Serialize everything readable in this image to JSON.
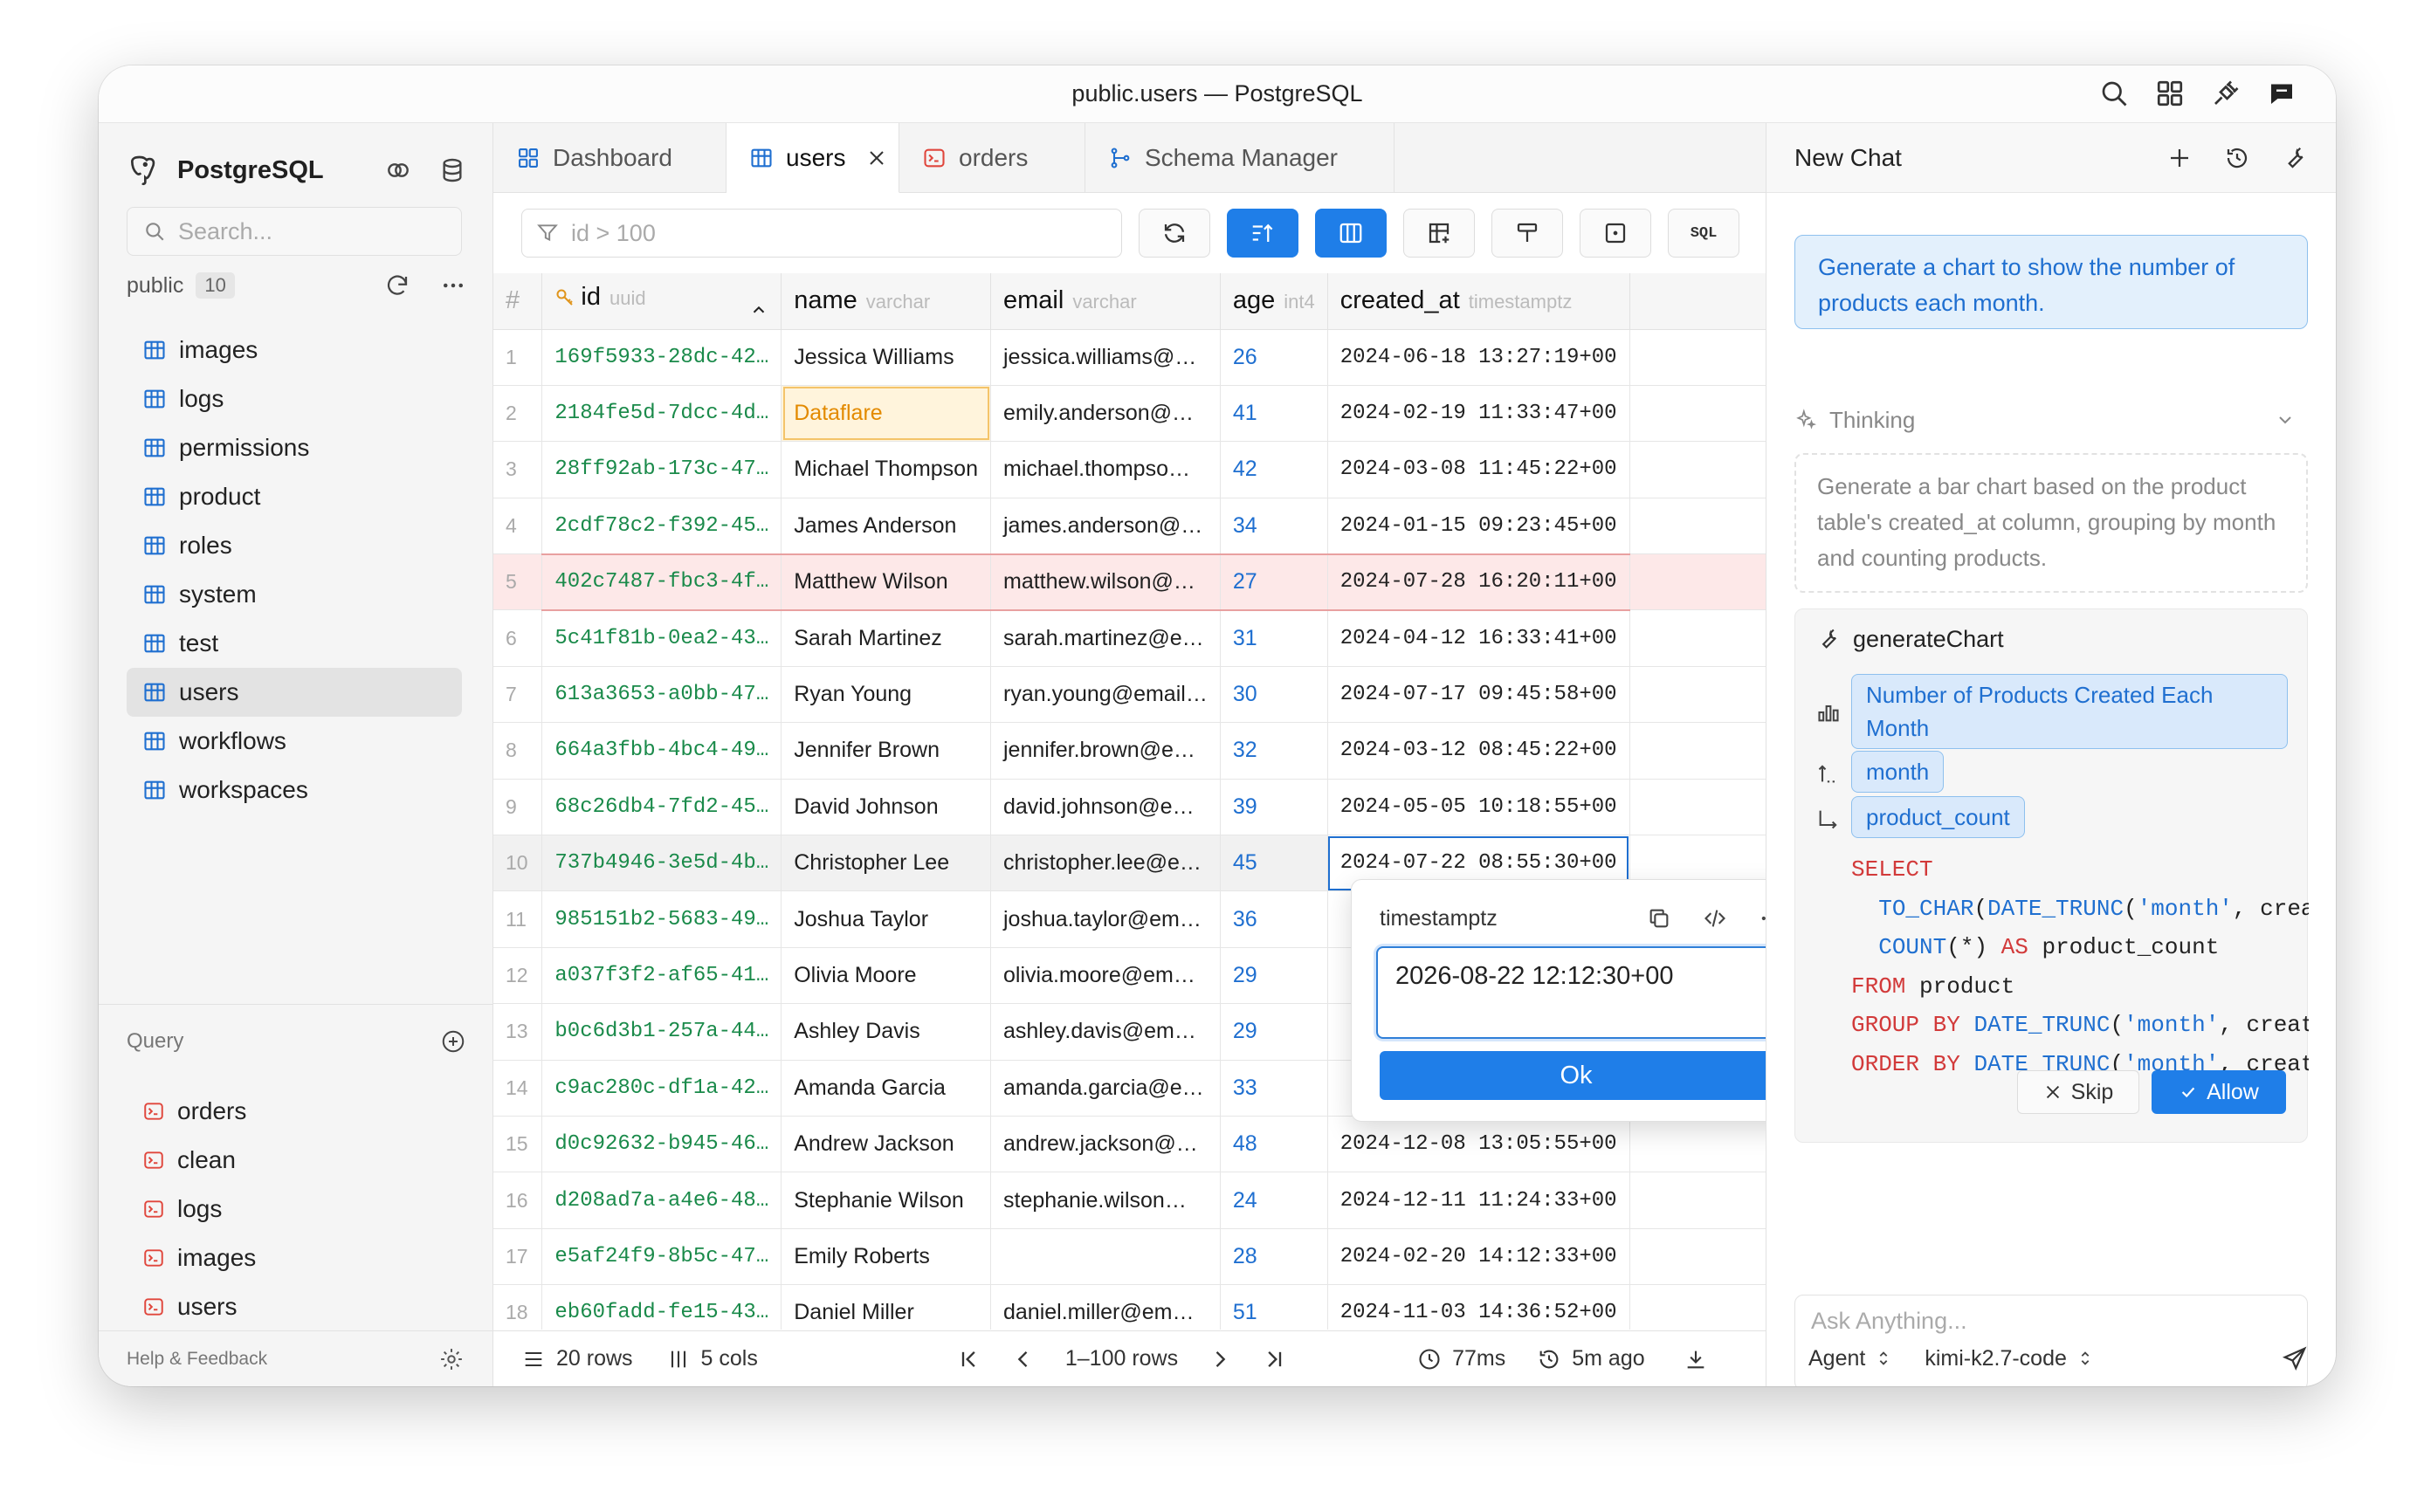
{
  "window": {
    "title": "public.users — PostgreSQL"
  },
  "sidebar": {
    "app_name": "PostgreSQL",
    "search_placeholder": "Search...",
    "schema": {
      "name": "public",
      "count": "10"
    },
    "tables": [
      {
        "label": "images"
      },
      {
        "label": "logs"
      },
      {
        "label": "permissions"
      },
      {
        "label": "product"
      },
      {
        "label": "roles"
      },
      {
        "label": "system"
      },
      {
        "label": "test"
      },
      {
        "label": "users",
        "selected": true
      },
      {
        "label": "workflows"
      },
      {
        "label": "workspaces"
      }
    ],
    "query_header": "Query",
    "queries": [
      {
        "label": "orders"
      },
      {
        "label": "clean"
      },
      {
        "label": "logs"
      },
      {
        "label": "images"
      },
      {
        "label": "users"
      }
    ],
    "footer": "Help & Feedback"
  },
  "tabs": [
    {
      "label": "Dashboard",
      "icon": "dashboard-icon"
    },
    {
      "label": "users",
      "icon": "table-icon",
      "active": true
    },
    {
      "label": "orders",
      "icon": "terminal-icon"
    },
    {
      "label": "Schema Manager",
      "icon": "schema-icon"
    }
  ],
  "toolbar": {
    "filter_placeholder": "id > 100",
    "sql_label": "SQL"
  },
  "grid": {
    "columns": [
      {
        "name": "#",
        "type": ""
      },
      {
        "name": "id",
        "type": "uuid"
      },
      {
        "name": "name",
        "type": "varchar"
      },
      {
        "name": "email",
        "type": "varchar"
      },
      {
        "name": "age",
        "type": "int4"
      },
      {
        "name": "created_at",
        "type": "timestamptz"
      }
    ],
    "rows": [
      {
        "n": "1",
        "id": "169f5933-28dc-42…",
        "name": "Jessica Williams",
        "email": "jessica.williams@…",
        "age": "26",
        "created": "2024-06-18 13:27:19+00"
      },
      {
        "n": "2",
        "id": "2184fe5d-7dcc-4d…",
        "name": "Dataflare",
        "email": "emily.anderson@…",
        "age": "41",
        "created": "2024-02-19 11:33:47+00"
      },
      {
        "n": "3",
        "id": "28ff92ab-173c-47…",
        "name": "Michael Thompson",
        "email": "michael.thompso…",
        "age": "42",
        "created": "2024-03-08 11:45:22+00"
      },
      {
        "n": "4",
        "id": "2cdf78c2-f392-45…",
        "name": "James Anderson",
        "email": "james.anderson@…",
        "age": "34",
        "created": "2024-01-15 09:23:45+00"
      },
      {
        "n": "5",
        "id": "402c7487-fbc3-4f…",
        "name": "Matthew Wilson",
        "email": "matthew.wilson@…",
        "age": "27",
        "created": "2024-07-28 16:20:11+00"
      },
      {
        "n": "6",
        "id": "5c41f81b-0ea2-43…",
        "name": "Sarah Martinez",
        "email": "sarah.martinez@e…",
        "age": "31",
        "created": "2024-04-12 16:33:41+00"
      },
      {
        "n": "7",
        "id": "613a3653-a0bb-47…",
        "name": "Ryan Young",
        "email": "ryan.young@email…",
        "age": "30",
        "created": "2024-07-17 09:45:58+00"
      },
      {
        "n": "8",
        "id": "664a3fbb-4bc4-49…",
        "name": "Jennifer Brown",
        "email": "jennifer.brown@e…",
        "age": "32",
        "created": "2024-03-12 08:45:22+00"
      },
      {
        "n": "9",
        "id": "68c26db4-7fd2-45…",
        "name": "David Johnson",
        "email": "david.johnson@e…",
        "age": "39",
        "created": "2024-05-05 10:18:55+00"
      },
      {
        "n": "10",
        "id": "737b4946-3e5d-4b…",
        "name": "Christopher Lee",
        "email": "christopher.lee@e…",
        "age": "45",
        "created": "2024-07-22 08:55:30+00"
      },
      {
        "n": "11",
        "id": "985151b2-5683-49…",
        "name": "Joshua Taylor",
        "email": "joshua.taylor@em…",
        "age": "36",
        "created": ""
      },
      {
        "n": "12",
        "id": "a037f3f2-af65-41…",
        "name": "Olivia Moore",
        "email": "olivia.moore@em…",
        "age": "29",
        "created": ""
      },
      {
        "n": "13",
        "id": "b0c6d3b1-257a-44…",
        "name": "Ashley Davis",
        "email": "ashley.davis@em…",
        "age": "29",
        "created": ""
      },
      {
        "n": "14",
        "id": "c9ac280c-df1a-42…",
        "name": "Amanda Garcia",
        "email": "amanda.garcia@e…",
        "age": "33",
        "created": ""
      },
      {
        "n": "15",
        "id": "d0c92632-b945-46…",
        "name": "Andrew Jackson",
        "email": "andrew.jackson@…",
        "age": "48",
        "created": "2024-12-08 13:05:55+00"
      },
      {
        "n": "16",
        "id": "d208ad7a-a4e6-48…",
        "name": "Stephanie Wilson",
        "email": "stephanie.wilson…",
        "age": "24",
        "created": "2024-12-11 11:24:33+00"
      },
      {
        "n": "17",
        "id": "e5af24f9-8b5c-47…",
        "name": "Emily Roberts",
        "email": "",
        "age": "28",
        "created": "2024-02-20 14:12:33+00"
      },
      {
        "n": "18",
        "id": "eb60fadd-fe15-43…",
        "name": "Daniel Miller",
        "email": "daniel.miller@em…",
        "age": "51",
        "created": "2024-11-03 14:36:52+00"
      }
    ]
  },
  "status": {
    "rows": "20 rows",
    "cols": "5 cols",
    "range": "1–100 rows",
    "time": "77ms",
    "ago": "5m ago"
  },
  "editor": {
    "type": "timestamptz",
    "value": "2026-08-22 12:12:30+00",
    "ok": "Ok"
  },
  "chat": {
    "title": "New Chat",
    "user_message": "Generate a chart to show the number of products each month.",
    "thinking_label": "Thinking",
    "thinking_text": "Generate a bar chart based on the product table's created_at column, grouping by month and counting products.",
    "tool_name": "generateChart",
    "chart_title": "Number of Products Created Each Month",
    "x_field": "month",
    "y_field": "product_count",
    "skip": "Skip",
    "allow": "Allow",
    "ask_placeholder": "Ask Anything...",
    "mode": "Agent",
    "model": "kimi-k2.7-code"
  }
}
